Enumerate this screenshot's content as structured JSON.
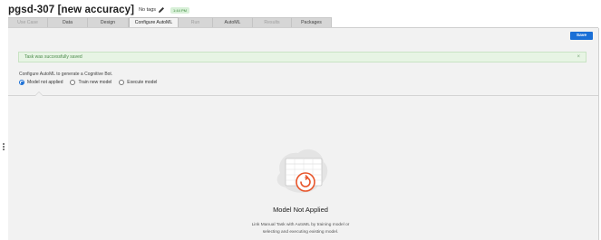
{
  "header": {
    "title": "pgsd-307 [new accuracy]",
    "tags": "No tags",
    "time_badge": "1:44 PM"
  },
  "tabs": [
    {
      "label": "Use Case",
      "state": "disabled"
    },
    {
      "label": "Data",
      "state": "normal"
    },
    {
      "label": "Design",
      "state": "normal"
    },
    {
      "label": "Configure AutoML",
      "state": "active"
    },
    {
      "label": "Run",
      "state": "disabled"
    },
    {
      "label": "AutoML",
      "state": "normal"
    },
    {
      "label": "Results",
      "state": "disabled"
    },
    {
      "label": "Packages",
      "state": "normal"
    }
  ],
  "toolbar": {
    "save_label": "Save"
  },
  "alert": {
    "text": "Task was successfully saved",
    "close": "×"
  },
  "config": {
    "label": "Configure AutoML to generate a Cognitive Bot.",
    "options": [
      {
        "label": "Model not applied",
        "checked": true
      },
      {
        "label": "Train new model",
        "checked": false
      },
      {
        "label": "Execute model",
        "checked": false
      }
    ]
  },
  "empty_state": {
    "title": "Model Not Applied",
    "description_line1": "Link Manual Task with AutoML by training model or",
    "description_line2": "selecting and executing existing model."
  },
  "colors": {
    "accent": "#1a6fd6",
    "success_bg": "#e7f4e4",
    "illustration_accent": "#e8552a"
  },
  "icons": [
    "pencil-icon",
    "close-icon",
    "model-not-applied-illustration",
    "drag-handle-icon"
  ]
}
